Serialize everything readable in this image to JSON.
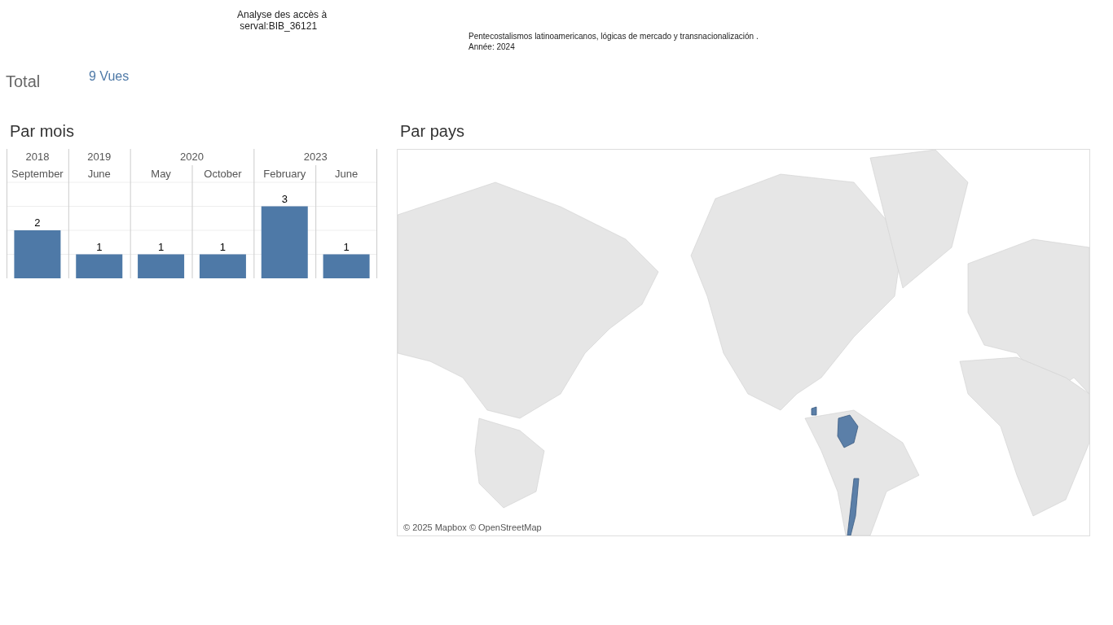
{
  "header": {
    "title_lines": [
      "Analyse des accès à",
      " serval:BIB_36121"
    ],
    "subtitle_lines": [
      "Pentecostalismos latinoamericanos, lógicas de mercado y transnacionalización .",
      "Année: 2024"
    ]
  },
  "total": {
    "label": "Total",
    "value": "9 Vues"
  },
  "by_month": {
    "title": "Par mois",
    "chart_data": {
      "type": "bar",
      "categories": [
        "September",
        "June",
        "May",
        "October",
        "February",
        "June"
      ],
      "values": [
        2,
        1,
        1,
        1,
        3,
        1
      ],
      "data_labels": true,
      "ylim": [
        0,
        4
      ]
    },
    "year_groups": [
      {
        "label": "2018"
      },
      {
        "label": "2019"
      },
      {
        "label": "2020"
      },
      {
        "label": "2023"
      }
    ],
    "month_columns": [
      {
        "starts_year": true
      },
      {
        "starts_year": true
      },
      {
        "starts_year": true
      },
      {
        "starts_year": false
      },
      {
        "starts_year": true
      },
      {
        "starts_year": false
      }
    ]
  },
  "by_country": {
    "title": "Par pays",
    "attribution": "© 2025 Mapbox © OpenStreetMap"
  }
}
